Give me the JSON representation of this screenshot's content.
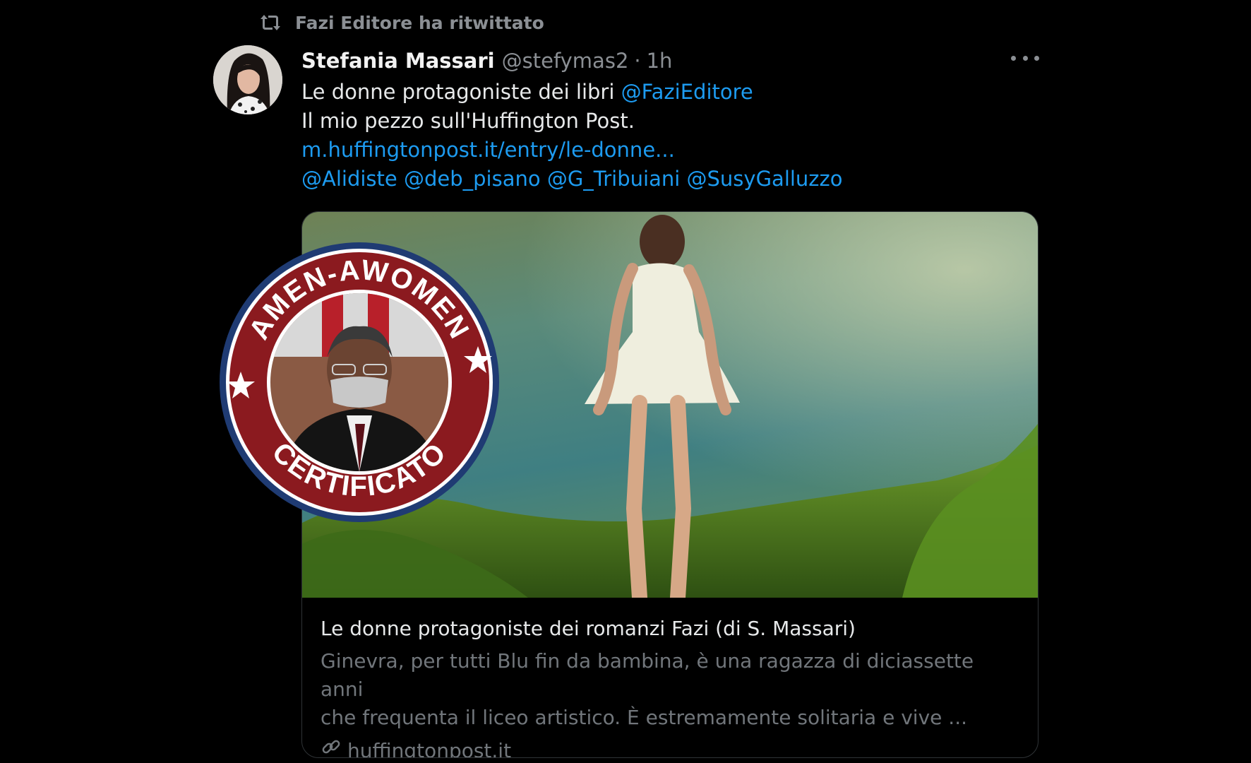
{
  "retweet": {
    "label": "Fazi Editore ha ritwittato",
    "icon": "retweet-icon"
  },
  "tweet": {
    "author_name": "Stefania Massari",
    "author_handle": "@stefymas2",
    "separator": "·",
    "time": "1h",
    "text_line1_prefix": "Le donne protagoniste dei libri ",
    "text_line1_mention": "@FaziEditore",
    "text_line2": "Il mio pezzo sull'Huffington Post.",
    "link_text": "m.huffingtonpost.it/entry/le-donne...",
    "mentions": [
      "@Alidiste",
      "@deb_pisano",
      "@G_Tribuiani",
      "@SusyGalluzzo"
    ]
  },
  "card": {
    "title": "Le donne protagoniste dei romanzi Fazi (di S. Massari)",
    "description_line1": "Ginevra, per tutti Blu fin da bambina, è una ragazza di diciassette anni",
    "description_line2": "che frequenta il liceo artistico. È estremamente solitaria e vive ...",
    "domain": "huffingtonpost.it",
    "domain_icon": "link-icon"
  },
  "badge": {
    "top_text": "AMEN-AWOMEN",
    "bottom_text": "CERTIFICATO",
    "ring_color": "#8b1a1f",
    "border_color": "#1f3b73"
  },
  "colors": {
    "background": "#000000",
    "text": "#e7e9ea",
    "muted": "#8b8f94",
    "link": "#1d9bf0"
  }
}
